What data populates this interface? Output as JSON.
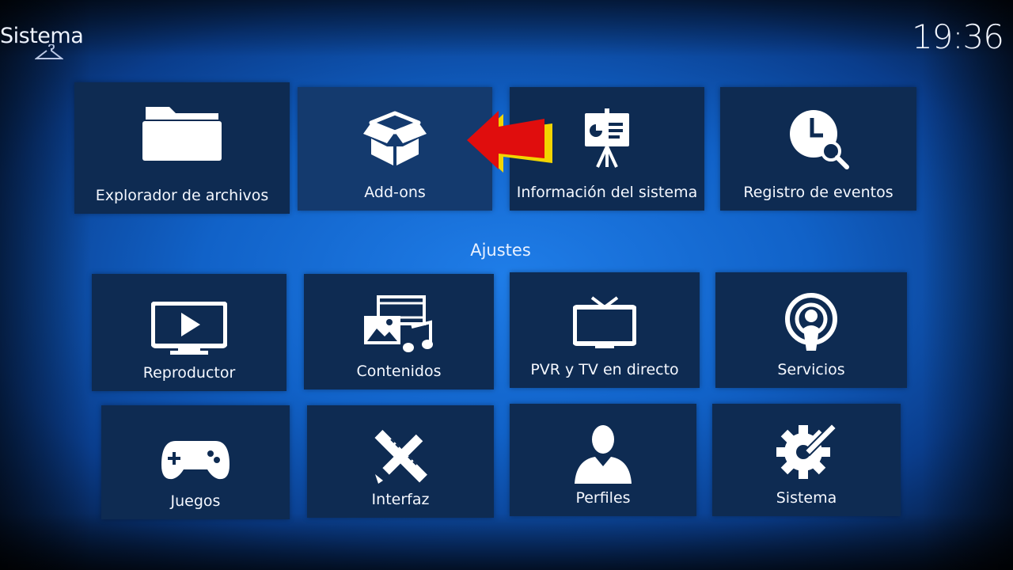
{
  "window": {
    "title": "Sistema",
    "clock": "19:36"
  },
  "top_row": [
    {
      "label": "Explorador de archivos",
      "icon": "folder-icon"
    },
    {
      "label": "Add-ons",
      "icon": "box-icon"
    },
    {
      "label": "Información del sistema",
      "icon": "presentation-icon"
    },
    {
      "label": "Registro de eventos",
      "icon": "clock-search-icon"
    }
  ],
  "section": {
    "title": "Ajustes"
  },
  "settings": [
    {
      "label": "Reproductor",
      "icon": "monitor-play-icon"
    },
    {
      "label": "Contenidos",
      "icon": "media-icon"
    },
    {
      "label": "PVR y TV en directo",
      "icon": "tv-icon"
    },
    {
      "label": "Servicios",
      "icon": "podcast-icon"
    },
    {
      "label": "Juegos",
      "icon": "gamepad-icon"
    },
    {
      "label": "Interfaz",
      "icon": "pencil-ruler-icon"
    },
    {
      "label": "Perfiles",
      "icon": "user-icon"
    },
    {
      "label": "Sistema",
      "icon": "gear-wrench-icon"
    }
  ],
  "colors": {
    "tile_bg": "#0e2b52",
    "accent_blue": "#1f7de8",
    "arrow_red": "#e00d0d",
    "arrow_yellow": "#f2d400"
  }
}
